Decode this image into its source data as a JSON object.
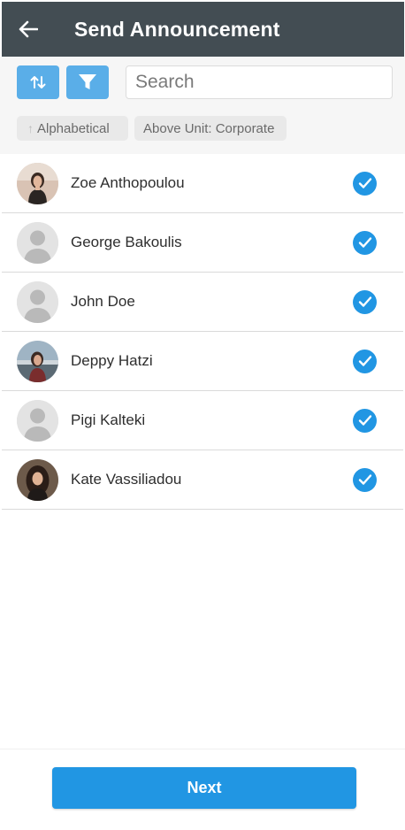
{
  "header": {
    "title": "Send Announcement",
    "back_icon": "arrow-left-icon"
  },
  "toolbar": {
    "sort_icon": "sort-arrows-icon",
    "filter_icon": "filter-funnel-icon",
    "search": {
      "placeholder": "Search",
      "value": ""
    },
    "chips": [
      {
        "label": "Alphabetical",
        "icon": "arrow-up-icon"
      },
      {
        "label": "Above Unit: Corporate"
      }
    ]
  },
  "recipients": [
    {
      "name": "Zoe Anthopoulou",
      "avatar": "photo",
      "checked": true
    },
    {
      "name": "George Bakoulis",
      "avatar": "placeholder",
      "checked": true
    },
    {
      "name": "John Doe",
      "avatar": "placeholder",
      "checked": true
    },
    {
      "name": "Deppy Hatzi",
      "avatar": "photo",
      "checked": true
    },
    {
      "name": "Pigi Kalteki",
      "avatar": "placeholder",
      "checked": true
    },
    {
      "name": "Kate Vassiliadou",
      "avatar": "photo",
      "checked": true
    }
  ],
  "footer": {
    "next_label": "Next"
  },
  "colors": {
    "app_bar": "#434d53",
    "accent": "#2196e3",
    "toolbar_button": "#5aaee8"
  }
}
